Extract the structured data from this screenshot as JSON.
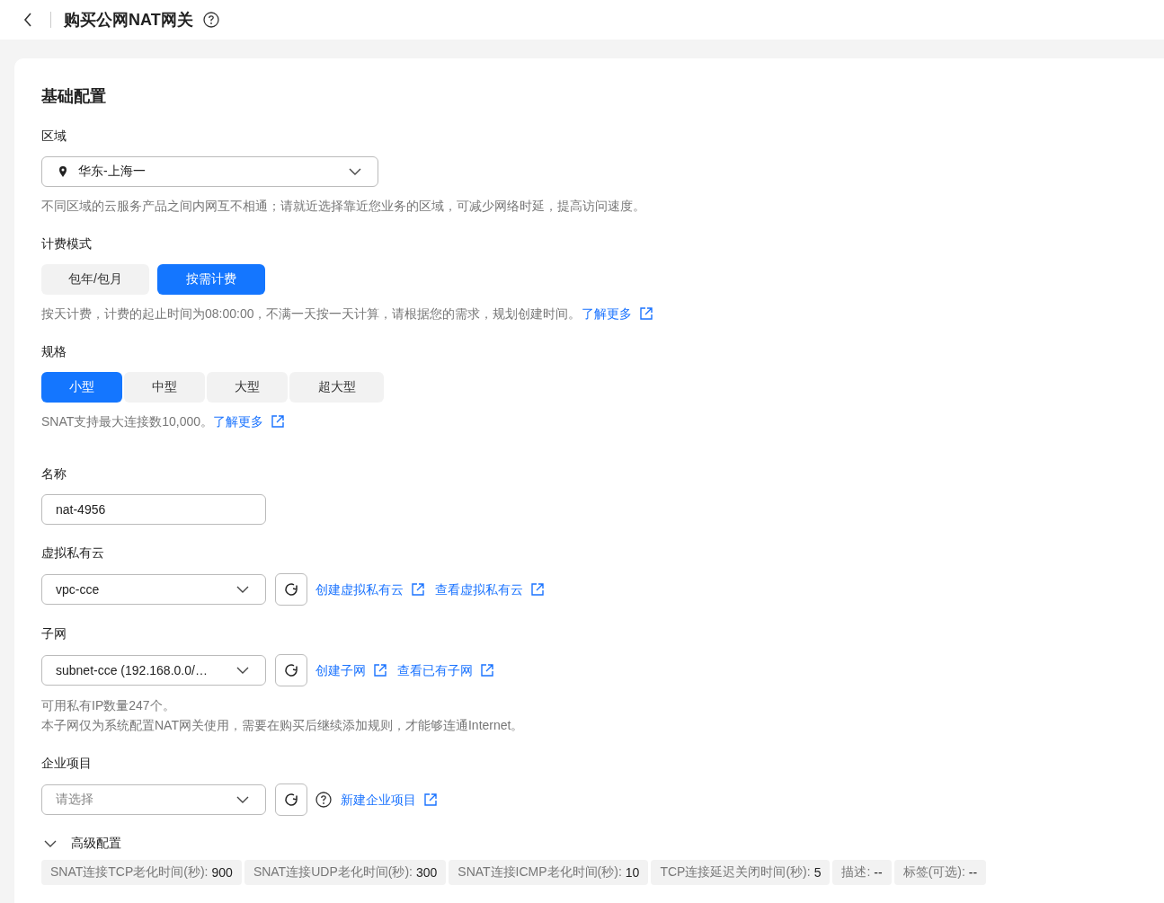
{
  "header": {
    "title": "购买公网NAT网关"
  },
  "section_title": "基础配置",
  "region": {
    "label": "区域",
    "value": "华东-上海一",
    "hint": "不同区域的云服务产品之间内网互不相通；请就近选择靠近您业务的区域，可减少网络时延，提高访问速度。"
  },
  "billing": {
    "label": "计费模式",
    "options": [
      {
        "label": "包年/包月",
        "selected": false
      },
      {
        "label": "按需计费",
        "selected": true
      }
    ],
    "hint": "按天计费，计费的起止时间为08:00:00，不满一天按一天计算，请根据您的需求，规划创建时间。",
    "link": "了解更多"
  },
  "spec": {
    "label": "规格",
    "options": [
      {
        "label": "小型",
        "selected": true
      },
      {
        "label": "中型",
        "selected": false
      },
      {
        "label": "大型",
        "selected": false
      },
      {
        "label": "超大型",
        "selected": false
      }
    ],
    "hint": "SNAT支持最大连接数10,000。",
    "link": "了解更多"
  },
  "name": {
    "label": "名称",
    "value": "nat-4956"
  },
  "vpc": {
    "label": "虚拟私有云",
    "value": "vpc-cce",
    "links": [
      "创建虚拟私有云",
      "查看虚拟私有云"
    ]
  },
  "subnet": {
    "label": "子网",
    "value": "subnet-cce (192.168.0.0/…",
    "links": [
      "创建子网",
      "查看已有子网"
    ],
    "hints": [
      "可用私有IP数量247个。",
      "本子网仅为系统配置NAT网关使用，需要在购买后继续添加规则，才能够连通Internet。"
    ]
  },
  "project": {
    "label": "企业项目",
    "placeholder": "请选择",
    "link": "新建企业项目"
  },
  "advanced": {
    "title": "高级配置",
    "expanded": true,
    "tags": [
      {
        "label": "SNAT连接TCP老化时间(秒):",
        "value": "900"
      },
      {
        "label": "SNAT连接UDP老化时间(秒):",
        "value": "300"
      },
      {
        "label": "SNAT连接ICMP老化时间(秒):",
        "value": "10"
      },
      {
        "label": "TCP连接延迟关闭时间(秒):",
        "value": "5"
      },
      {
        "label": "描述:",
        "value": "--"
      },
      {
        "label": "标签(可选):",
        "value": "--"
      }
    ]
  }
}
